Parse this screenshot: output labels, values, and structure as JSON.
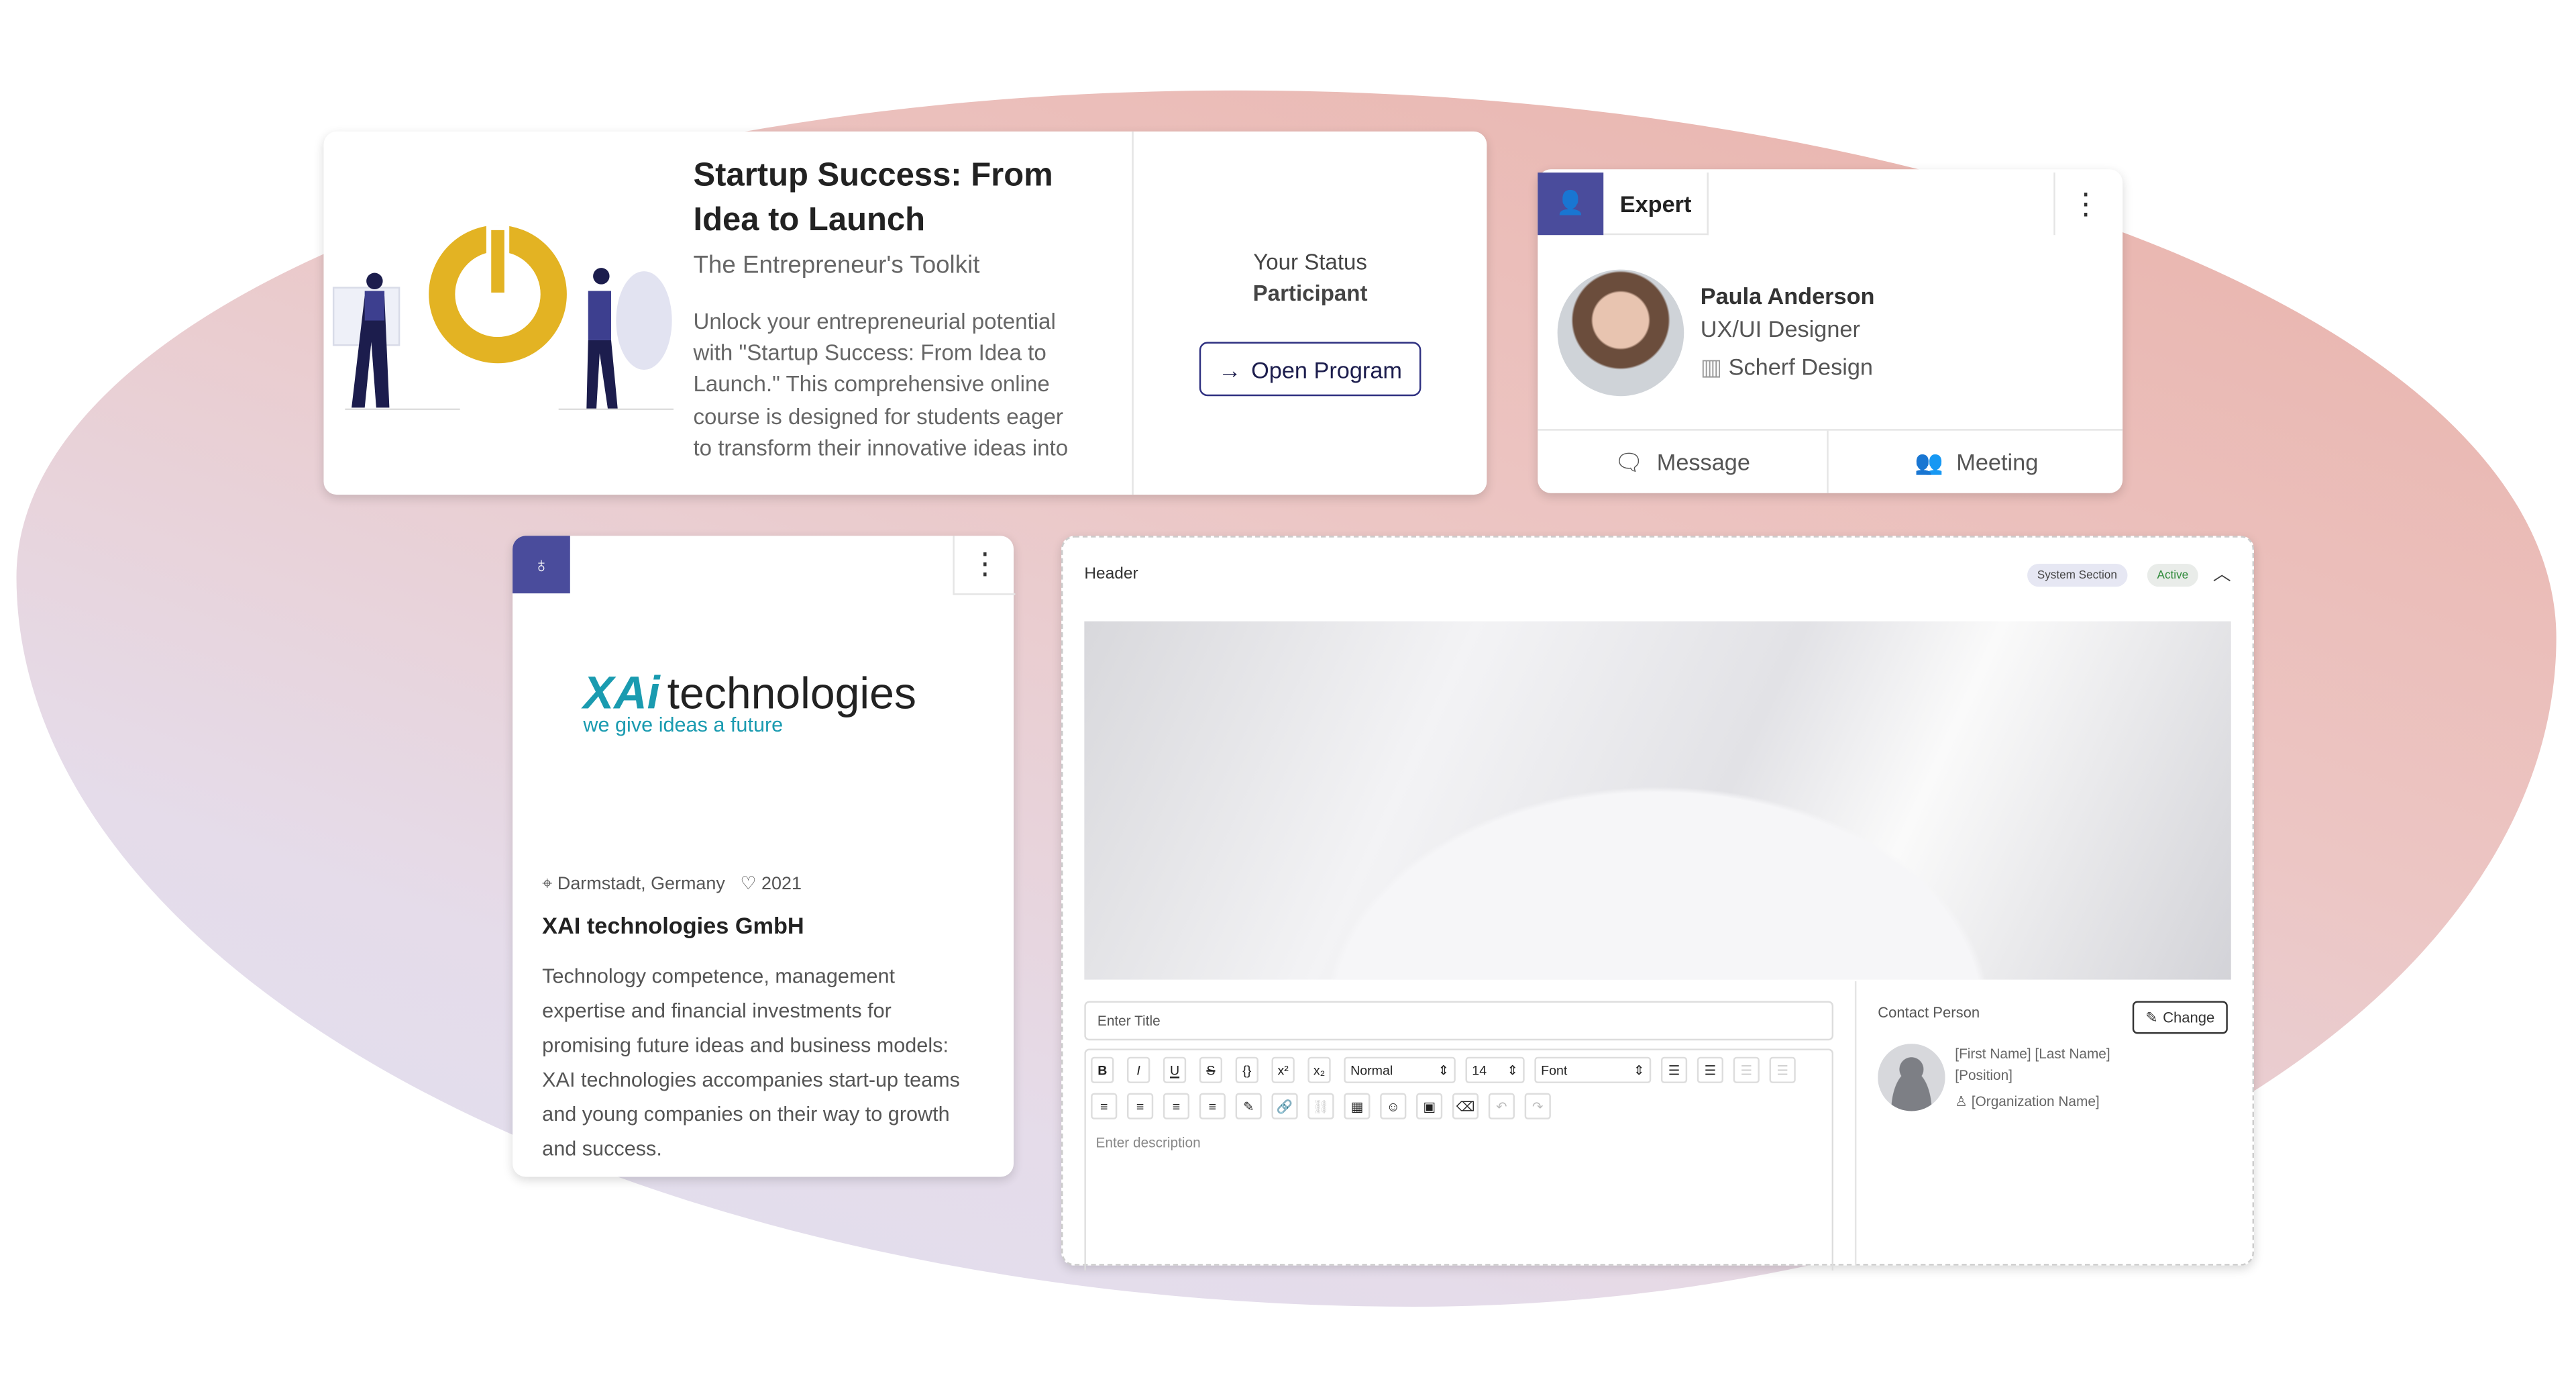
{
  "program": {
    "title_line1": "Startup Success: From",
    "title_line2": "Idea to Launch",
    "subtitle": "The Entrepreneur's Toolkit",
    "description": [
      "Unlock your entrepreneurial potential",
      "with \"Startup Success: From Idea to",
      "Launch.\" This comprehensive online",
      "course is designed for students eager",
      "to transform their innovative ideas into"
    ],
    "status_label": "Your Status",
    "status_value": "Participant",
    "open_button": "Open Program"
  },
  "expert": {
    "tab_label": "Expert",
    "name": "Paula Anderson",
    "role": "UX/UI Designer",
    "company": "Scherf Design",
    "message_button": "Message",
    "meeting_button": "Meeting"
  },
  "company": {
    "logo_text": "technologies",
    "logo_tagline": "we give ideas a future",
    "location": "Darmstadt, Germany",
    "founded": "2021",
    "name": "XAI technologies GmbH",
    "description": [
      "Technology competence, management",
      "expertise and financial investments for",
      "promising future ideas and business models:",
      "XAI technologies accompanies start-up teams",
      "and young companies on their way to growth",
      "and success."
    ]
  },
  "editor": {
    "section_title": "Header",
    "badge_system": "System Section",
    "badge_active": "Active",
    "title_placeholder": "Enter Title",
    "description_placeholder": "Enter description",
    "style_select": "Normal",
    "size_select": "14",
    "font_select": "Font",
    "contact_label": "Contact Person",
    "change_button": "Change",
    "contact_name": "[First Name] [Last Name]",
    "contact_position": "[Position]",
    "contact_org": "[Organization Name]"
  },
  "colors": {
    "accent": "#3d3f8f",
    "brand_teal": "#1a9bb0",
    "illustration_yellow": "#e3b323",
    "navy": "#1c1d4d"
  }
}
